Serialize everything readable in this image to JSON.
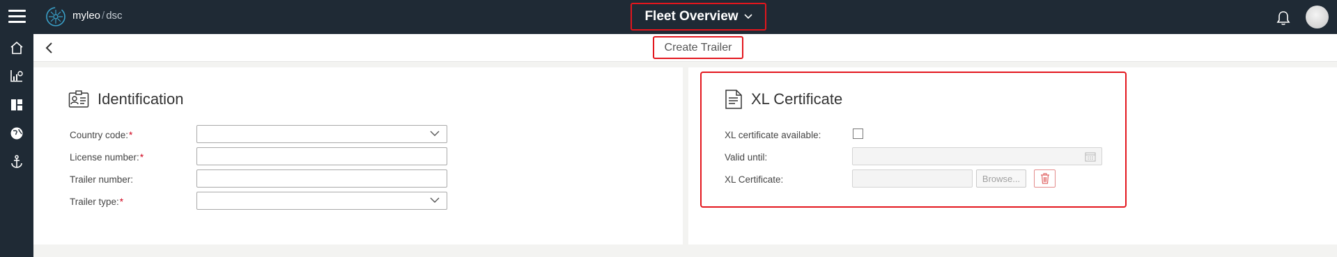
{
  "app": {
    "brand_name": "myleo",
    "brand_separator": "/",
    "brand_suffix": "dsc",
    "view_title": "Fleet Overview"
  },
  "subheader": {
    "title": "Create Trailer"
  },
  "identification": {
    "title": "Identification",
    "fields": [
      {
        "label": "Country code:",
        "required_mark": "*",
        "value": ""
      },
      {
        "label": "License number:",
        "required_mark": "*",
        "value": ""
      },
      {
        "label": "Trailer number:",
        "required_mark": "",
        "value": ""
      },
      {
        "label": "Trailer type:",
        "required_mark": "*",
        "value": ""
      }
    ]
  },
  "xl_certificate": {
    "title": "XL Certificate",
    "available_label": "XL certificate available:",
    "available_checked": false,
    "valid_until_label": "Valid until:",
    "valid_until_value": "",
    "file_label": "XL Certificate:",
    "file_value": "",
    "browse_label": "Browse..."
  },
  "colors": {
    "nav_bg": "#1f2a35",
    "highlight_red": "#e3161d",
    "required_red": "#d0021b"
  }
}
